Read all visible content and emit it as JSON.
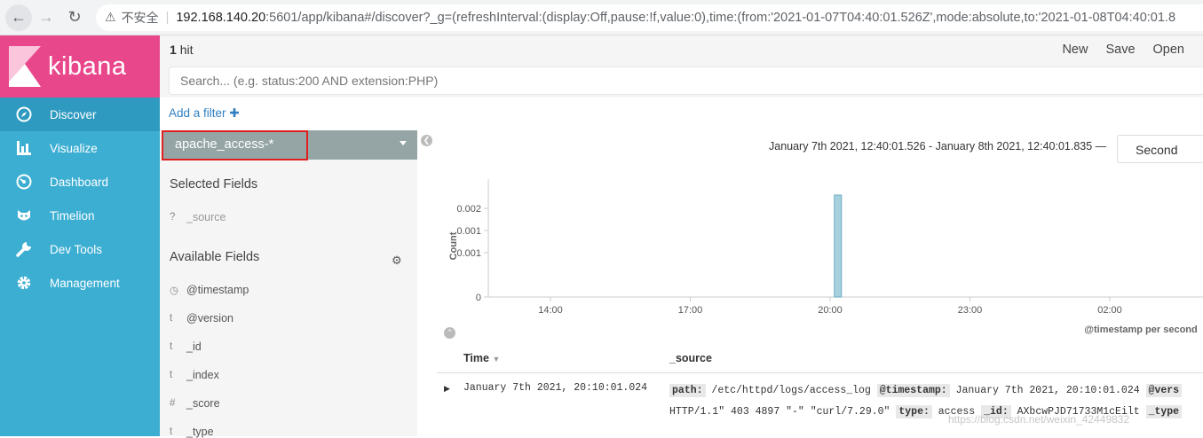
{
  "browser": {
    "insecure_label": "不安全",
    "url_host": "192.168.140.20",
    "url_rest": ":5601/app/kibana#/discover?_g=(refreshInterval:(display:Off,pause:!f,value:0),time:(from:'2021-01-07T04:40:01.526Z',mode:absolute,to:'2021-01-08T04:40:01.8"
  },
  "sidebar": {
    "brand": "kibana",
    "items": [
      {
        "label": "Discover",
        "icon": "compass-icon"
      },
      {
        "label": "Visualize",
        "icon": "bar-chart-icon"
      },
      {
        "label": "Dashboard",
        "icon": "gauge-icon"
      },
      {
        "label": "Timelion",
        "icon": "timelion-icon"
      },
      {
        "label": "Dev Tools",
        "icon": "wrench-icon"
      },
      {
        "label": "Management",
        "icon": "gear-icon"
      }
    ],
    "active": "Discover"
  },
  "topbar": {
    "hits_count": "1",
    "hits_label": "hit",
    "menu": [
      "New",
      "Save",
      "Open"
    ],
    "search_placeholder": "Search... (e.g. status:200 AND extension:PHP)",
    "add_filter": "Add a filter"
  },
  "fields": {
    "index_pattern": "apache_access-*",
    "selected_heading": "Selected Fields",
    "selected": [
      {
        "type": "?",
        "name": "_source"
      }
    ],
    "available_heading": "Available Fields",
    "available": [
      {
        "type": "◷",
        "name": "@timestamp"
      },
      {
        "type": "t",
        "name": "@version"
      },
      {
        "type": "t",
        "name": "_id"
      },
      {
        "type": "t",
        "name": "_index"
      },
      {
        "type": "#",
        "name": "_score"
      },
      {
        "type": "t",
        "name": "_type"
      }
    ]
  },
  "histogram": {
    "time_range": "January 7th 2021, 12:40:01.526 - January 8th 2021, 12:40:01.835 —",
    "interval": "Second"
  },
  "chart_data": {
    "type": "bar",
    "ylabel": "Count",
    "xlabel": "@timestamp per second",
    "y_ticks": [
      "0.002",
      "0.001",
      "0.001",
      "0"
    ],
    "ylim": [
      0,
      0.0025
    ],
    "x_ticks": [
      "14:00",
      "17:00",
      "20:00",
      "23:00",
      "02:00"
    ],
    "x_tick_hours": [
      14,
      17,
      20,
      23,
      26
    ],
    "x_range_hours": [
      12.667,
      28.0
    ],
    "bars": [
      {
        "x_hour": 20.167,
        "value": 0.0023
      }
    ]
  },
  "documents": {
    "col_time": "Time",
    "col_source": "_source",
    "rows": [
      {
        "time": "January 7th 2021, 20:10:01.024",
        "line1": [
          {
            "k": "path:",
            "v": "/etc/httpd/logs/access_log"
          },
          {
            "k": "@timestamp:",
            "v": "January 7th 2021, 20:10:01.024"
          },
          {
            "k": "@vers",
            "v": ""
          }
        ],
        "line2_prefix": "HTTP/1.1\" 403 4897 \"-\" \"curl/7.29.0\"",
        "line2": [
          {
            "k": "type:",
            "v": "access"
          },
          {
            "k": "_id:",
            "v": "AXbcwPJD71733M1cEilt"
          },
          {
            "k": "_type",
            "v": ""
          }
        ]
      }
    ]
  },
  "watermark": "https://blog.csdn.net/weixin_42449832"
}
